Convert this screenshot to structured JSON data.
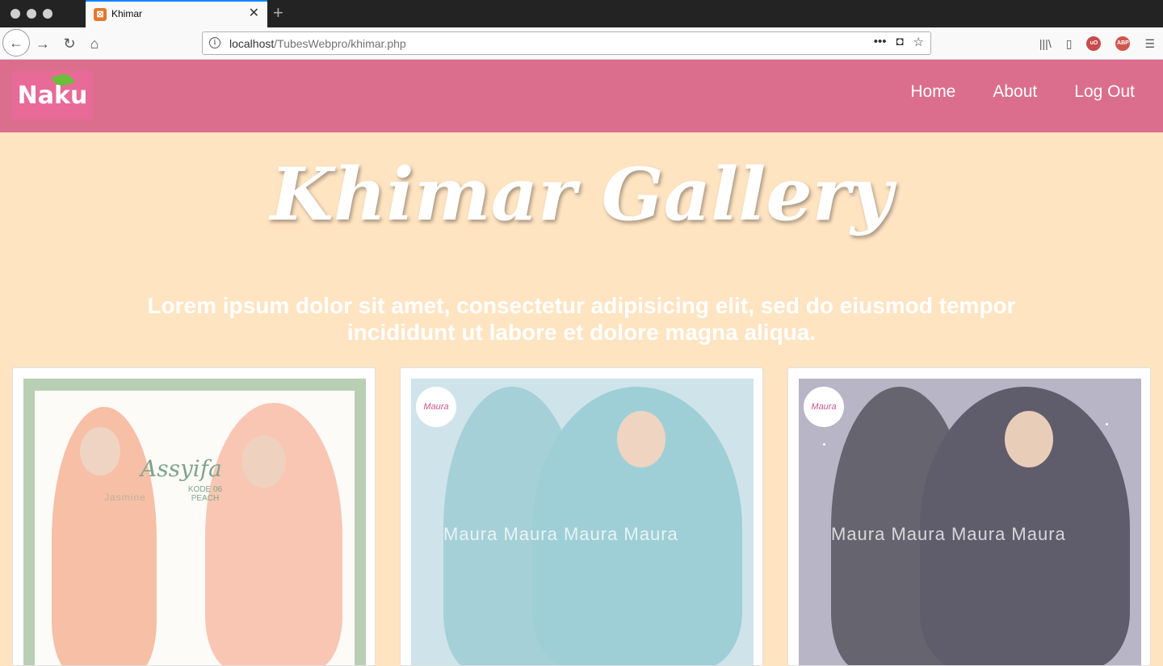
{
  "browser": {
    "tab_title": "Khimar",
    "url_host": "localhost",
    "url_path": "/TubesWebpro/khimar.php"
  },
  "site": {
    "logo_text": "Naku",
    "nav": [
      {
        "label": "Home"
      },
      {
        "label": "About"
      },
      {
        "label": "Log Out"
      }
    ],
    "hero_title": "Khimar Gallery",
    "hero_subtitle": "Lorem ipsum dolor sit amet, consectetur adipisicing elit, sed do eiusmod tempor incididunt ut labore et dolore magna aliqua.",
    "products": [
      {
        "brand": "Assyifa",
        "code": "KODE 06",
        "color_name": "PEACH",
        "watermark": "Jasmine",
        "color": "#f7c1a8"
      },
      {
        "brand": "Maura",
        "watermark": "Maura Maura Maura Maura",
        "color": "#9fcfd6"
      },
      {
        "brand": "Maura",
        "watermark": "Maura Maura Maura Maura",
        "color": "#5f5d6b"
      }
    ]
  }
}
